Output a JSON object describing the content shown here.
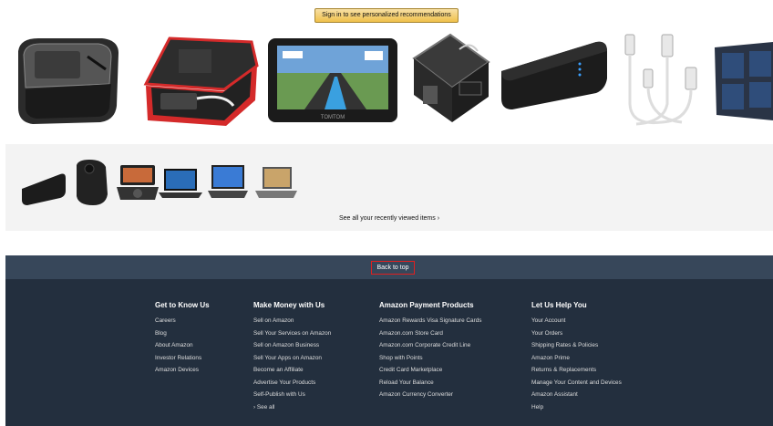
{
  "signin": {
    "label": "Sign in to see personalized recommendations"
  },
  "products": [
    {
      "icon": "travel-case-icon"
    },
    {
      "icon": "red-travel-case-icon"
    },
    {
      "icon": "gps-navigator-icon"
    },
    {
      "icon": "organizer-pouch-icon"
    },
    {
      "icon": "power-bank-icon"
    },
    {
      "icon": "usb-cable-icon"
    },
    {
      "icon": "solar-panel-icon"
    }
  ],
  "recent": {
    "items": [
      {
        "icon": "power-bank-icon"
      },
      {
        "icon": "camera-case-icon"
      },
      {
        "icon": "portable-dvd-icon"
      },
      {
        "icon": "laptop-icon"
      },
      {
        "icon": "laptop-icon"
      },
      {
        "icon": "laptop-icon"
      }
    ],
    "see_all": "See all your recently viewed items ›"
  },
  "footer": {
    "back_to_top": "Back to top",
    "columns": [
      {
        "title": "Get to Know Us",
        "links": [
          "Careers",
          "Blog",
          "About Amazon",
          "Investor Relations",
          "Amazon Devices"
        ]
      },
      {
        "title": "Make Money with Us",
        "links": [
          "Sell on Amazon",
          "Sell Your Services on Amazon",
          "Sell on Amazon Business",
          "Sell Your Apps on Amazon",
          "Become an Affiliate",
          "Advertise Your Products",
          "Self-Publish with Us",
          "› See all"
        ]
      },
      {
        "title": "Amazon Payment Products",
        "links": [
          "Amazon Rewards Visa Signature Cards",
          "Amazon.com Store Card",
          "Amazon.com Corporate Credit Line",
          "Shop with Points",
          "Credit Card Marketplace",
          "Reload Your Balance",
          "Amazon Currency Converter"
        ]
      },
      {
        "title": "Let Us Help You",
        "links": [
          "Your Account",
          "Your Orders",
          "Shipping Rates & Policies",
          "Amazon Prime",
          "Returns & Replacements",
          "Manage Your Content and Devices",
          "Amazon Assistant",
          "Help"
        ]
      }
    ]
  },
  "colors": {
    "footer_bg": "#232f3e",
    "backtop_bg": "#37475a",
    "button_gold": "#f0c14b"
  }
}
